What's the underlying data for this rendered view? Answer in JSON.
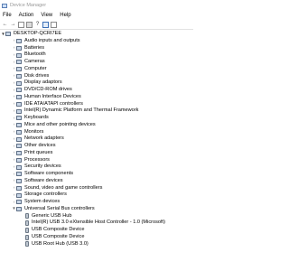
{
  "window": {
    "title": "Device Manager"
  },
  "menu": [
    "File",
    "Action",
    "View",
    "Help"
  ],
  "toolbar": [
    {
      "name": "back-icon",
      "glyph": "←"
    },
    {
      "name": "forward-icon",
      "glyph": "→"
    },
    {
      "name": "show-hide-console-tree-icon",
      "glyph": ""
    },
    {
      "name": "properties-icon",
      "glyph": ""
    },
    {
      "name": "help-icon",
      "glyph": "?"
    },
    {
      "name": "update-driver-icon",
      "glyph": ""
    },
    {
      "name": "monitor-icon",
      "glyph": ""
    }
  ],
  "tree": {
    "root": "DESKTOP-QCRI7EE",
    "categories": [
      "Audio inputs and outputs",
      "Batteries",
      "Bluetooth",
      "Cameras",
      "Computer",
      "Disk drives",
      "Display adaptors",
      "DVD/CD-ROM drives",
      "Human Interface Devices",
      "IDE ATA/ATAPI controllers",
      "Intel(R) Dynamic Platform and Thermal Framework",
      "Keyboards",
      "Mice and other pointing devices",
      "Monitors",
      "Network adapters",
      "Other devices",
      "Print queues",
      "Processors",
      "Security devices",
      "Software components",
      "Software devices",
      "Sound, video and game controllers",
      "Storage controllers",
      "System devices"
    ],
    "expanded": {
      "label": "Universal Serial Bus controllers",
      "children": [
        "Generic USB Hub",
        "Intel(R) USB 3.0 eXtensible Host Controller - 1.0 (Microsoft)",
        "USB Composite Device",
        "USB Composite Device",
        "USB Root Hub (USB 3.0)"
      ]
    }
  }
}
